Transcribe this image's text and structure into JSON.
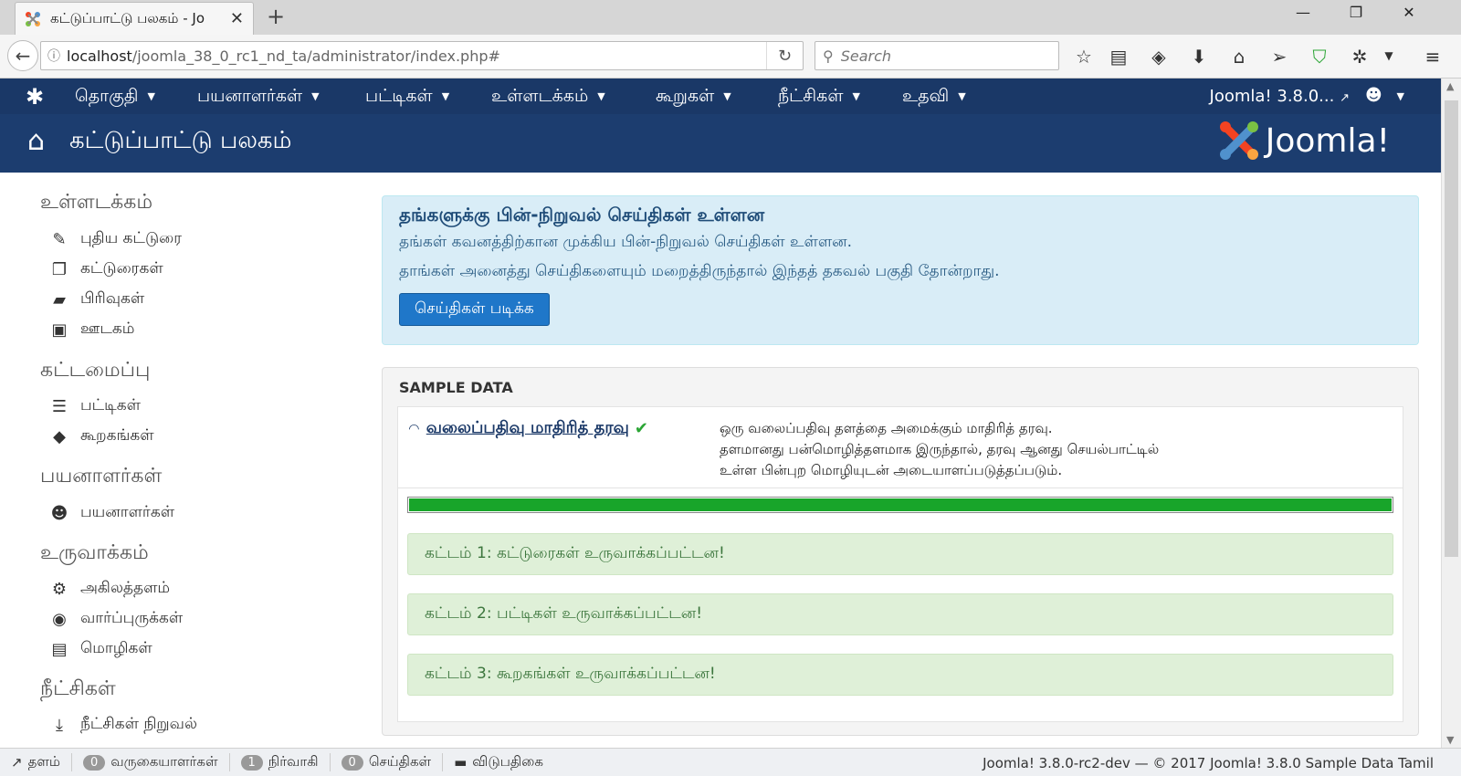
{
  "browser": {
    "tab_title": "கட்டுப்பாட்டு பலகம் - Jo",
    "tab_close": "✕",
    "new_tab": "+",
    "url_host": "localhost",
    "url_path": "/joomla_38_0_rc1_nd_ta/administrator/index.php#",
    "search_placeholder": "Search",
    "win_min": "—",
    "win_max": "❐",
    "win_close": "✕"
  },
  "menu": {
    "items": [
      "தொகுதி",
      "பயனாளர்கள்",
      "பட்டிகள்",
      "உள்ளடக்கம்",
      "கூறுகள்",
      "நீட்சிகள்",
      "உதவி"
    ],
    "site_link": "Joomla! 3.8.0...",
    "user_icon": "user-icon"
  },
  "header": {
    "title": "கட்டுப்பாட்டு பலகம்",
    "logo_text": "Joomla!"
  },
  "sidebar": {
    "sections": [
      {
        "heading": "உள்ளடக்கம்",
        "items": [
          {
            "icon": "pencil-icon",
            "glyph": "✎",
            "label": "புதிய கட்டுரை"
          },
          {
            "icon": "copy-icon",
            "glyph": "❐",
            "label": "கட்டுரைகள்"
          },
          {
            "icon": "folder-icon",
            "glyph": "▰",
            "label": "பிரிவுகள்"
          },
          {
            "icon": "image-icon",
            "glyph": "▣",
            "label": "ஊடகம்"
          }
        ]
      },
      {
        "heading": "கட்டமைப்பு",
        "items": [
          {
            "icon": "list-icon",
            "glyph": "☰",
            "label": "பட்டிகள்"
          },
          {
            "icon": "cube-icon",
            "glyph": "◆",
            "label": "கூறகங்கள்"
          }
        ]
      },
      {
        "heading": "பயனாளர்கள்",
        "items": [
          {
            "icon": "users-icon",
            "glyph": "☻",
            "label": "பயனாளர்கள்"
          }
        ]
      },
      {
        "heading": "உருவாக்கம்",
        "items": [
          {
            "icon": "cog-icon",
            "glyph": "⚙",
            "label": "அகிலத்தளம்"
          },
          {
            "icon": "eye-icon",
            "glyph": "◉",
            "label": "வார்ப்புருக்கள்"
          },
          {
            "icon": "comments-icon",
            "glyph": "▤",
            "label": "மொழிகள்"
          }
        ]
      },
      {
        "heading": "நீட்சிகள்",
        "items": [
          {
            "icon": "download-icon",
            "glyph": "⤓",
            "label": "நீட்சிகள் நிறுவல்"
          }
        ]
      }
    ]
  },
  "alert": {
    "heading": "தங்களுக்கு பின்-நிறுவல் செய்திகள் உள்ளன",
    "line1": "தங்கள் கவனத்திற்கான முக்கிய பின்-நிறுவல் செய்திகள் உள்ளன.",
    "line2": "தாங்கள் அனைத்து செய்திகளையும் மறைத்திருந்தால் இந்தத் தகவல் பகுதி தோன்றாது.",
    "button": "செய்திகள் படிக்க"
  },
  "sample_data": {
    "heading": "SAMPLE DATA",
    "link": "வலைப்பதிவு மாதிரித் தரவு",
    "desc1": "ஒரு வலைப்பதிவு தளத்தை அமைக்கும் மாதிரித் தரவு.",
    "desc2": "தளமானது பன்மொழித்தளமாக இருந்தால், தரவு ஆனது செயல்பாட்டில்",
    "desc3": "உள்ள பின்புற மொழியுடன் அடையாளப்படுத்தப்படும்.",
    "progress_percent": 100,
    "steps": [
      "கட்டம் 1: கட்டுரைகள் உருவாக்கப்பட்டன!",
      "கட்டம் 2: பட்டிகள் உருவாக்கப்பட்டன!",
      "கட்டம் 3: கூறகங்கள் உருவாக்கப்பட்டன!"
    ]
  },
  "status": {
    "site": "தளம்",
    "visitors_count": "0",
    "visitors": "வருகையாளர்கள்",
    "admin_count": "1",
    "admin": "நிர்வாகி",
    "messages_count": "0",
    "messages": "செய்திகள்",
    "logout": "விடுபதிகை",
    "copyright": "Joomla! 3.8.0-rc2-dev — © 2017 Joomla! 3.8.0 Sample Data Tamil"
  }
}
